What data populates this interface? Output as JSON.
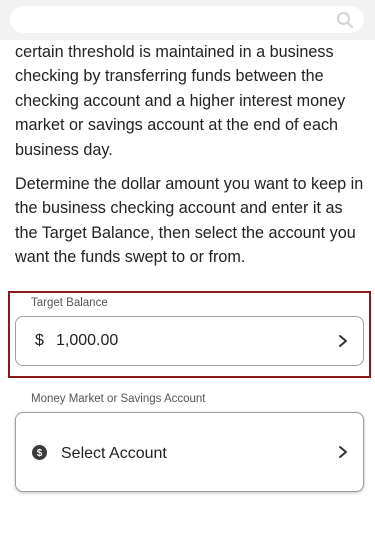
{
  "search": {
    "icon": "search-icon"
  },
  "intro": {
    "paragraph1": "certain threshold is maintained in a business checking by transferring funds between the checking account and a higher interest money market or savings account at the end of each business day.",
    "paragraph2": "Determine the dollar amount you want to keep in the business checking account and enter it as the Target Balance, then select the account you want the funds swept to or from."
  },
  "target_balance": {
    "label": "Target Balance",
    "currency_symbol": "$",
    "value": "1,000.00"
  },
  "account": {
    "label": "Money Market or Savings Account",
    "placeholder": "Select Account",
    "icon": "dollar-circle-icon"
  },
  "colors": {
    "highlight_border": "#8b1a1a",
    "field_border": "#9e9e9e",
    "text": "#222222",
    "background": "#f2f2f2"
  }
}
